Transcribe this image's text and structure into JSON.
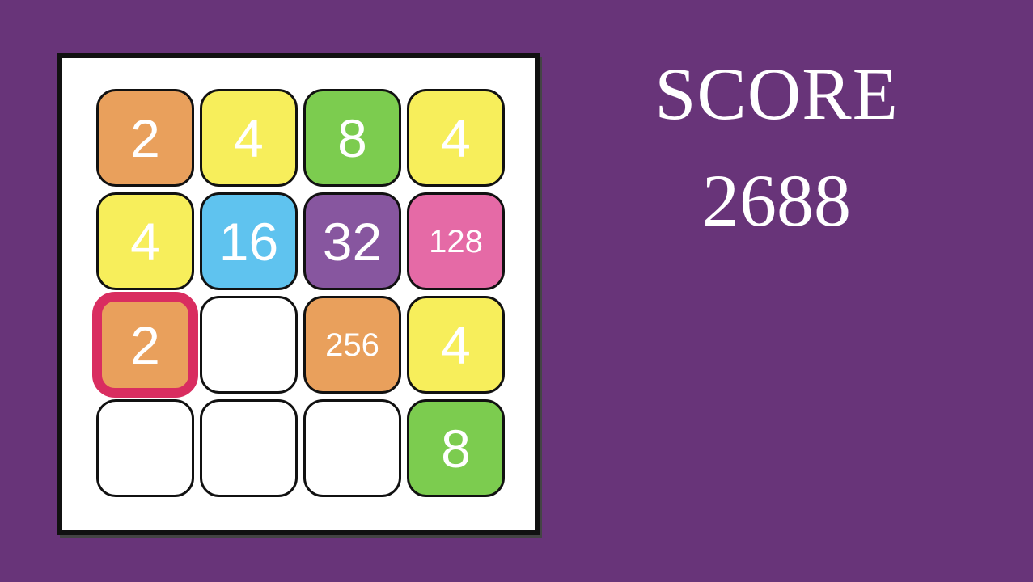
{
  "game": {
    "score_label": "SCORE",
    "score_value": "2688"
  },
  "board": {
    "tiles": [
      {
        "value": "2",
        "color": "#e9a05c"
      },
      {
        "value": "4",
        "color": "#f7ee5b"
      },
      {
        "value": "8",
        "color": "#7ccc4f"
      },
      {
        "value": "4",
        "color": "#f7ee5b"
      },
      {
        "value": "4",
        "color": "#f7ee5b"
      },
      {
        "value": "16",
        "color": "#5fc3ef"
      },
      {
        "value": "32",
        "color": "#87569f"
      },
      {
        "value": "128",
        "color": "#e56aa6"
      },
      {
        "value": "2",
        "color": "#e9a05c",
        "selected": true
      },
      {
        "value": "",
        "color": "#ffffff"
      },
      {
        "value": "256",
        "color": "#e9a05c"
      },
      {
        "value": "4",
        "color": "#f7ee5b"
      },
      {
        "value": "",
        "color": "#ffffff"
      },
      {
        "value": "",
        "color": "#ffffff"
      },
      {
        "value": "",
        "color": "#ffffff"
      },
      {
        "value": "8",
        "color": "#7ccc4f"
      }
    ]
  },
  "colors": {
    "background": "#683479",
    "selection_border": "#d92d60"
  }
}
